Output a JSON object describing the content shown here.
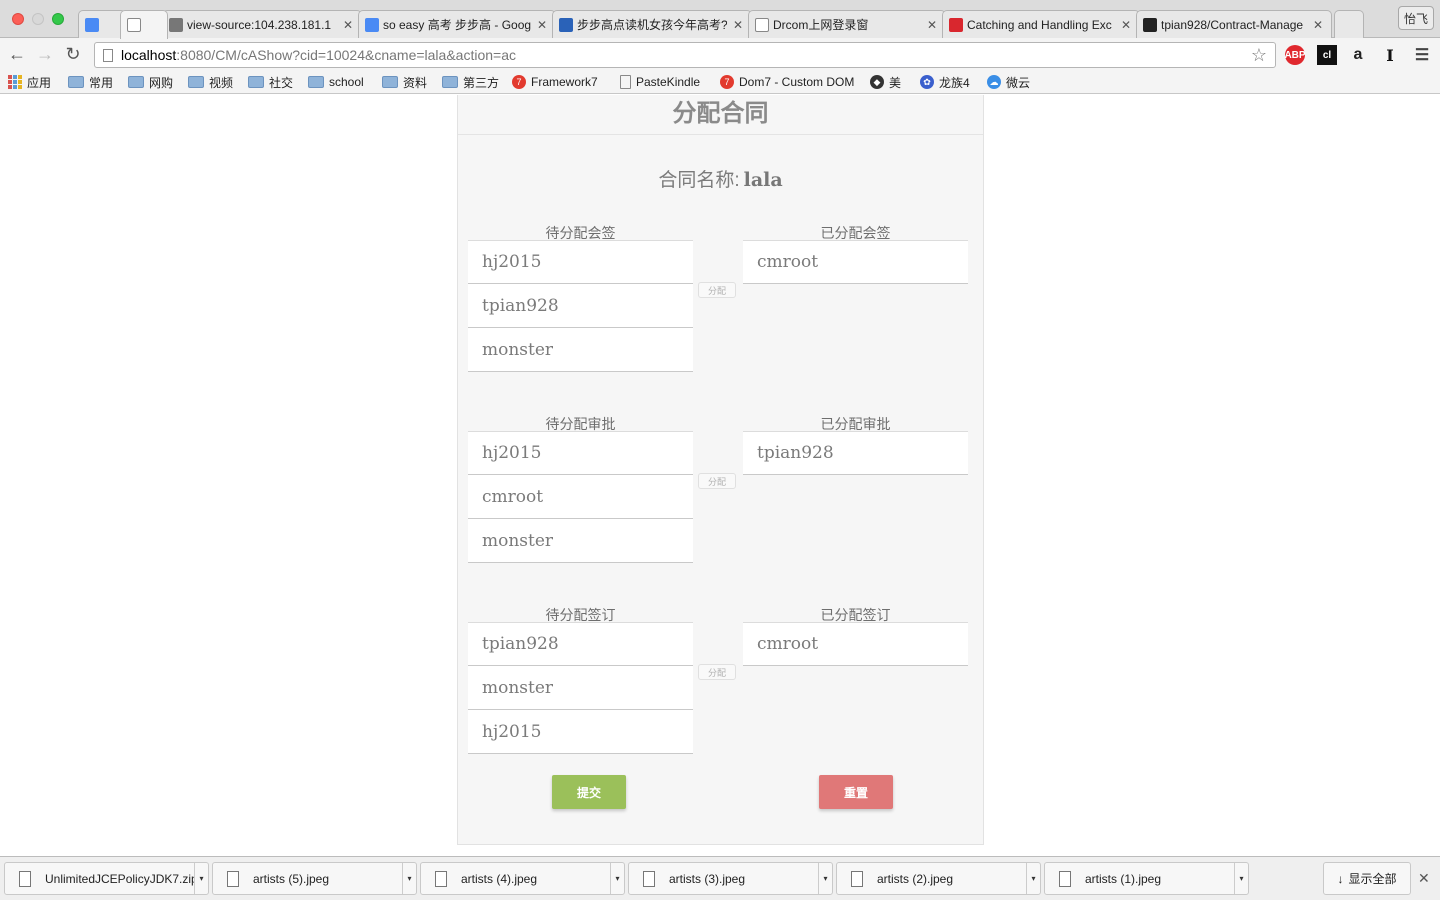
{
  "browser": {
    "profile_name": "怡飞",
    "tabs": [
      {
        "label": "",
        "icon": "translate-icon",
        "color": "#4a8af4"
      },
      {
        "label": "",
        "icon": "blank-page-icon",
        "color": "#ffffff",
        "active": true
      },
      {
        "label": "view-source:104.238.181.1",
        "icon": "image-icon",
        "color": "#777777"
      },
      {
        "label": "so easy 高考 步步高 - Goog",
        "icon": "google-icon",
        "color": "#4a8af4"
      },
      {
        "label": "步步高点读机女孩今年高考?",
        "icon": "bird-icon",
        "color": "#2a62b8"
      },
      {
        "label": "Drcom上网登录窗",
        "icon": "page-icon",
        "color": "#ffffff"
      },
      {
        "label": "Catching and Handling Exc",
        "icon": "oracle-icon",
        "color": "#d9272e"
      },
      {
        "label": "tpian928/Contract-Manage",
        "icon": "github-icon",
        "color": "#222222"
      }
    ],
    "url_host": "localhost",
    "url_rest": ":8080/CM/cAShow?cid=10024&cname=lala&action=ac",
    "extensions": [
      "ABP",
      "cl",
      "a",
      "I"
    ],
    "bookmarks": [
      {
        "label": "应用",
        "type": "apps"
      },
      {
        "label": "常用",
        "type": "folder"
      },
      {
        "label": "网购",
        "type": "folder"
      },
      {
        "label": "视频",
        "type": "folder"
      },
      {
        "label": "社交",
        "type": "folder"
      },
      {
        "label": "school",
        "type": "folder"
      },
      {
        "label": "资料",
        "type": "folder"
      },
      {
        "label": "第三方",
        "type": "folder"
      },
      {
        "label": "Framework7",
        "type": "site",
        "glyph": "7",
        "color": "#e23a2e"
      },
      {
        "label": "PasteKindle",
        "type": "page"
      },
      {
        "label": "Dom7 - Custom DOM",
        "type": "site",
        "glyph": "7",
        "color": "#e23a2e"
      },
      {
        "label": "美",
        "type": "site",
        "glyph": "◆",
        "color": "#333333"
      },
      {
        "label": "龙族4",
        "type": "site",
        "glyph": "✿",
        "color": "#3a5fcd"
      },
      {
        "label": "微云",
        "type": "site",
        "glyph": "☁",
        "color": "#3a8ee6"
      }
    ]
  },
  "page": {
    "title": "分配合同",
    "contract_label": "合同名称:",
    "contract_name": "lala",
    "assign_label": "分配",
    "groups": [
      {
        "pending_title": "待分配会签",
        "assigned_title": "已分配会签",
        "pending": [
          "hj2015",
          "tpian928",
          "monster"
        ],
        "assigned": [
          "cmroot"
        ]
      },
      {
        "pending_title": "待分配审批",
        "assigned_title": "已分配审批",
        "pending": [
          "hj2015",
          "cmroot",
          "monster"
        ],
        "assigned": [
          "tpian928"
        ]
      },
      {
        "pending_title": "待分配签订",
        "assigned_title": "已分配签订",
        "pending": [
          "tpian928",
          "monster",
          "hj2015"
        ],
        "assigned": [
          "cmroot"
        ]
      }
    ],
    "submit_label": "提交",
    "reset_label": "重置",
    "submit_color": "#9bc05a",
    "reset_color": "#e07878"
  },
  "downloads": {
    "items": [
      "UnlimitedJCEPolicyJDK7.zip",
      "artists (5).jpeg",
      "artists (4).jpeg",
      "artists (3).jpeg",
      "artists (2).jpeg",
      "artists (1).jpeg"
    ],
    "show_all_label": "显示全部"
  }
}
